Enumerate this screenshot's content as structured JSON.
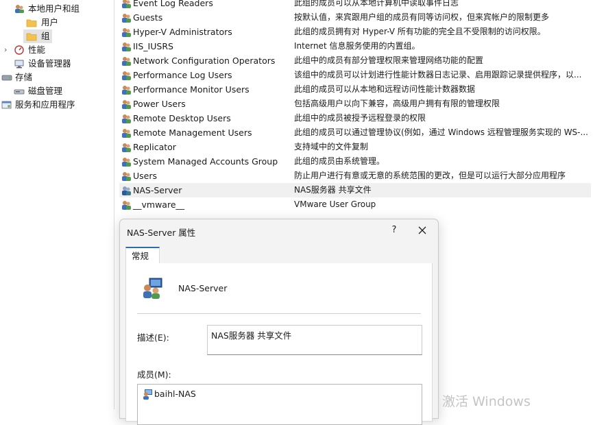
{
  "tree": {
    "items": [
      {
        "label": "本地用户和组",
        "icon": "users-groups-icon"
      },
      {
        "label": "用户",
        "icon": "folder-icon"
      },
      {
        "label": "组",
        "icon": "folder-icon"
      },
      {
        "label": "性能",
        "icon": "performance-icon"
      },
      {
        "label": "设备管理器",
        "icon": "device-manager-icon"
      },
      {
        "label": "存储",
        "icon": "storage-icon"
      },
      {
        "label": "磁盘管理",
        "icon": "disk-icon"
      },
      {
        "label": "服务和应用程序",
        "icon": "services-icon"
      }
    ]
  },
  "groups": [
    {
      "name": "Event Log Readers",
      "desc": "此组的成员可以从本地计算机中读取事件日志"
    },
    {
      "name": "Guests",
      "desc": "按默认值，来宾跟用户组的成员有同等访问权，但来宾帐户的限制更多"
    },
    {
      "name": "Hyper-V Administrators",
      "desc": "此组的成员拥有对 Hyper-V 所有功能的完全且不受限制的访问权限。"
    },
    {
      "name": "IIS_IUSRS",
      "desc": "Internet 信息服务使用的内置组。"
    },
    {
      "name": "Network Configuration Operators",
      "desc": "此组中的成员有部分管理权限来管理网络功能的配置"
    },
    {
      "name": "Performance Log Users",
      "desc": "该组中的成员可以计划进行性能计数器日志记录、启用跟踪记录提供程序，以..."
    },
    {
      "name": "Performance Monitor Users",
      "desc": "此组的成员可以从本地和远程访问性能计数器数据"
    },
    {
      "name": "Power Users",
      "desc": "包括高级用户以向下兼容，高级用户拥有有限的管理权限"
    },
    {
      "name": "Remote Desktop Users",
      "desc": "此组中的成员被授予远程登录的权限"
    },
    {
      "name": "Remote Management Users",
      "desc": "此组的成员可以通过管理协议(例如，通过 Windows 远程管理服务实现的 WS-..."
    },
    {
      "name": "Replicator",
      "desc": "支持域中的文件复制"
    },
    {
      "name": "System Managed Accounts Group",
      "desc": "此组的成员由系统管理。"
    },
    {
      "name": "Users",
      "desc": "防止用户进行有意或无意的系统范围的更改，但是可以运行大部分应用程序"
    },
    {
      "name": "NAS-Server",
      "desc": "NAS服务器 共享文件",
      "selected": true
    },
    {
      "name": "__vmware__",
      "desc": "VMware User Group"
    }
  ],
  "dialog": {
    "title": "NAS-Server 属性",
    "help": "?",
    "tab": "常规",
    "group_name": "NAS-Server",
    "desc_label": "描述(E):",
    "desc_value": "NAS服务器 共享文件",
    "members_label": "成员(M):",
    "members": [
      "baihl-NAS"
    ]
  },
  "watermark": "激活 Windows"
}
